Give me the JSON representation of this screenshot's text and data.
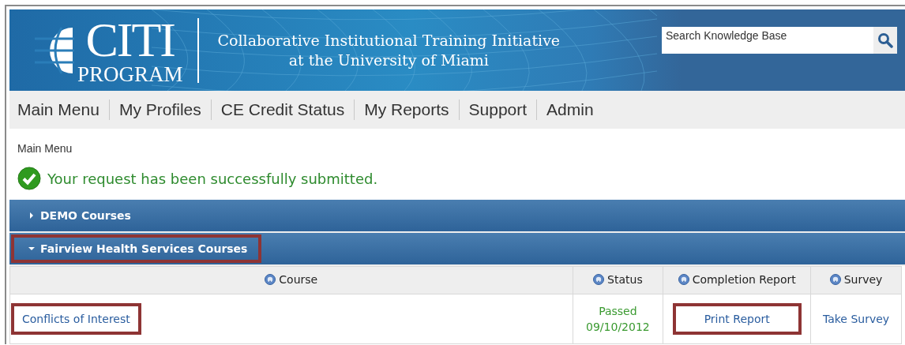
{
  "header": {
    "logo_top": "CITI",
    "logo_bottom": "PROGRAM",
    "title_lines": [
      "Collaborative Institutional Training Initiative",
      "at the University of Miami"
    ],
    "search": {
      "placeholder": "Search Knowledge Base"
    }
  },
  "nav": [
    "Main Menu",
    "My Profiles",
    "CE Credit Status",
    "My Reports",
    "Support",
    "Admin"
  ],
  "breadcrumb": "Main Menu",
  "message": {
    "kind": "success",
    "text": "Your request has been successfully submitted."
  },
  "sections": [
    {
      "title": "DEMO Courses",
      "expanded": false,
      "highlighted": false
    },
    {
      "title": "Fairview Health Services Courses",
      "expanded": true,
      "highlighted": true,
      "table": {
        "columns": [
          "Course",
          "Status",
          "Completion Report",
          "Survey"
        ],
        "rows": [
          {
            "course": {
              "text": "Conflicts of Interest",
              "highlighted": true
            },
            "status": [
              "Passed",
              "09/10/2012"
            ],
            "report": {
              "text": "Print Report",
              "highlighted": true
            },
            "survey": {
              "text": "Take Survey",
              "highlighted": false
            }
          }
        ]
      }
    }
  ]
}
